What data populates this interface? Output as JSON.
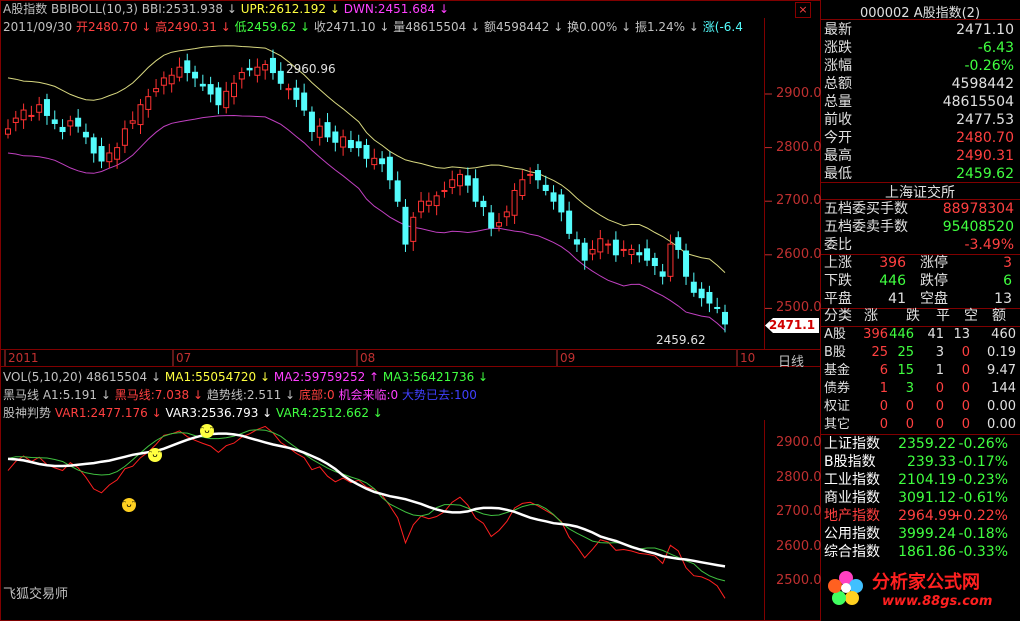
{
  "colors": {
    "bg": "#000000",
    "up": "#ff3232",
    "down": "#54fcfc",
    "grid": "#800000",
    "ma": "#ffffff",
    "upr": "#d8d880",
    "dwn": "#c040c0"
  },
  "header": {
    "line1": [
      {
        "t": "A股指数 BBIBOLL(10,3) BBI:2531.938",
        "c": "#c0c0c0"
      },
      {
        "t": "↓",
        "c": "#c0c0c0"
      },
      {
        "t": "UPR:2612.192",
        "c": "#ffff40"
      },
      {
        "t": "↓",
        "c": "#ffff40"
      },
      {
        "t": "DWN:2451.684",
        "c": "#ff40ff"
      },
      {
        "t": "↓",
        "c": "#ff40ff"
      }
    ],
    "line2": [
      {
        "t": "2011/09/30",
        "c": "#c0c0c0"
      },
      {
        "t": "开2480.70 ↓",
        "c": "#ff4040"
      },
      {
        "t": "高2490.31 ↓",
        "c": "#ff4040"
      },
      {
        "t": "低2459.62 ↓",
        "c": "#40ff40"
      },
      {
        "t": "收2471.10 ↓",
        "c": "#c0c0c0"
      },
      {
        "t": "量48615504 ↓",
        "c": "#c0c0c0"
      },
      {
        "t": "额4598442 ↓",
        "c": "#c0c0c0"
      },
      {
        "t": "换0.00% ↓",
        "c": "#c0c0c0"
      },
      {
        "t": "振1.24% ↓",
        "c": "#c0c0c0"
      },
      {
        "t": "涨(-6.4",
        "c": "#54fcfc"
      }
    ]
  },
  "main_chart": {
    "y_ticks": [
      "2900.0",
      "2800.0",
      "2700.0",
      "2600.0",
      "2500.0"
    ],
    "annot_high": "2960.96",
    "annot_low": "2459.62",
    "last_price": "2471.1",
    "date_ticks": [
      "2011",
      "07",
      "08",
      "09",
      "10"
    ],
    "period": "日线"
  },
  "vol_bar": [
    {
      "t": "VOL(5,10,20) 48615504 ↓",
      "c": "#c0c0c0"
    },
    {
      "t": "MA1:55054720 ↓",
      "c": "#ffff40"
    },
    {
      "t": "MA2:59759252 ↑",
      "c": "#ff40ff"
    },
    {
      "t": "MA3:56421736 ↓",
      "c": "#40ff40"
    }
  ],
  "ind_bar1": [
    {
      "t": "黑马线 A1:5.191 ↓",
      "c": "#c0c0c0"
    },
    {
      "t": "黑马线:7.038 ↓",
      "c": "#ff4040"
    },
    {
      "t": "趋势线:2.511 ↓",
      "c": "#c0c0c0"
    },
    {
      "t": "底部:0",
      "c": "#ff4040"
    },
    {
      "t": "机会来临:0",
      "c": "#ff40ff"
    },
    {
      "t": "大势已去:100",
      "c": "#4040ff"
    }
  ],
  "ind_bar2": [
    {
      "t": "股神判势",
      "c": "#c0c0c0"
    },
    {
      "t": "VAR1:2477.176 ↓",
      "c": "#ff4040"
    },
    {
      "t": "VAR3:2536.793 ↓",
      "c": "#ffffff"
    },
    {
      "t": "VAR4:2512.662 ↓",
      "c": "#40ff40"
    }
  ],
  "sub_chart": {
    "y_ticks": [
      "2900.0",
      "2800.0",
      "2700.0",
      "2600.0",
      "2500.0"
    ],
    "footer": "飞狐交易师"
  },
  "right_panel": {
    "title": "000002 A股指数(2)",
    "quote": [
      {
        "label": "最新",
        "value": "2471.10",
        "c": "#e0e0e0"
      },
      {
        "label": "涨跌",
        "value": "-6.43",
        "c": "#40ff40"
      },
      {
        "label": "涨幅",
        "value": "-0.26%",
        "c": "#40ff40"
      },
      {
        "label": "总额",
        "value": "4598442",
        "c": "#e0e0e0"
      },
      {
        "label": "总量",
        "value": "48615504",
        "c": "#e0e0e0"
      },
      {
        "label": "前收",
        "value": "2477.53",
        "c": "#e0e0e0"
      },
      {
        "label": "今开",
        "value": "2480.70",
        "c": "#ff4040"
      },
      {
        "label": "最高",
        "value": "2490.31",
        "c": "#ff4040"
      },
      {
        "label": "最低",
        "value": "2459.62",
        "c": "#40ff40"
      }
    ],
    "exchange": "上海证交所",
    "order": [
      {
        "label": "五档委买手数",
        "value": "88978304",
        "c": "#ff4040"
      },
      {
        "label": "五档委卖手数",
        "value": "95408520",
        "c": "#40ff40"
      },
      {
        "label": "委比",
        "value": "-3.49%",
        "c": "#ff4040"
      }
    ],
    "breadth": [
      {
        "l1": "上涨",
        "v1": "396",
        "c1": "#ff4040",
        "l2": "涨停",
        "v2": "3",
        "c2": "#ff4040"
      },
      {
        "l1": "下跌",
        "v1": "446",
        "c1": "#40ff40",
        "l2": "跌停",
        "v2": "6",
        "c2": "#40ff40"
      },
      {
        "l1": "平盘",
        "v1": "41",
        "c1": "#e0e0e0",
        "l2": "空盘",
        "v2": "13",
        "c2": "#e0e0e0"
      }
    ],
    "cls_head": [
      "分类",
      "涨",
      "跌",
      "平",
      "空",
      "额"
    ],
    "cls_rows": [
      {
        "n": "A股",
        "a": "396",
        "b": "446",
        "c": "41",
        "d": "13",
        "e": "460"
      },
      {
        "n": "B股",
        "a": "25",
        "b": "25",
        "c": "3",
        "d": "0",
        "e": "0.19"
      },
      {
        "n": "基金",
        "a": "6",
        "b": "15",
        "c": "1",
        "d": "0",
        "e": "9.47"
      },
      {
        "n": "债券",
        "a": "1",
        "b": "3",
        "c": "0",
        "d": "0",
        "e": "144"
      },
      {
        "n": "权证",
        "a": "0",
        "b": "0",
        "c": "0",
        "d": "0",
        "e": "0.00"
      },
      {
        "n": "其它",
        "a": "0",
        "b": "0",
        "c": "0",
        "d": "0",
        "e": "0.00"
      }
    ],
    "indices": [
      {
        "n": "上证指数",
        "v": "2359.22",
        "p": "-0.26%",
        "c": "#40ff40",
        "nc": "#ffffff"
      },
      {
        "n": "B股指数",
        "v": "239.33",
        "p": "-0.17%",
        "c": "#40ff40",
        "nc": "#ffffff"
      },
      {
        "n": "工业指数",
        "v": "2104.19",
        "p": "-0.23%",
        "c": "#40ff40",
        "nc": "#ffffff"
      },
      {
        "n": "商业指数",
        "v": "3091.12",
        "p": "-0.61%",
        "c": "#40ff40",
        "nc": "#ffffff"
      },
      {
        "n": "地产指数",
        "v": "2964.99",
        "p": "+0.22%",
        "c": "#ff4040",
        "nc": "#ff4040"
      },
      {
        "n": "公用指数",
        "v": "3999.24",
        "p": "-0.18%",
        "c": "#40ff40",
        "nc": "#ffffff"
      },
      {
        "n": "综合指数",
        "v": "1861.86",
        "p": "-0.33%",
        "c": "#40ff40",
        "nc": "#ffffff"
      }
    ],
    "logo_text": "分析家公式网",
    "logo_url": "www.88gs.com"
  }
}
